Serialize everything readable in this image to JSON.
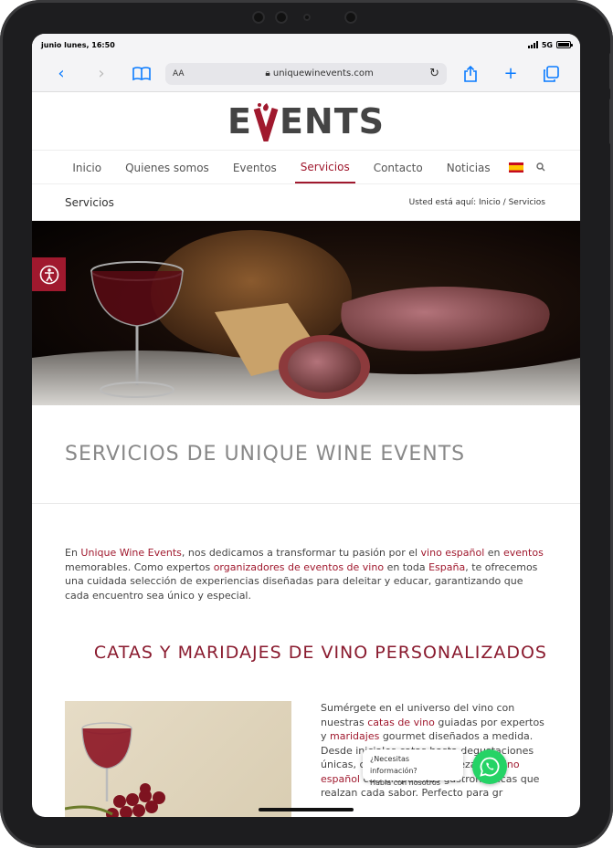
{
  "status": {
    "time": "junio lunes, 16:50",
    "network": "5G"
  },
  "browser": {
    "aa": "AA",
    "url": "uniquewinevents.com"
  },
  "site": {
    "logo": {
      "pre": "E",
      "v": "V",
      "post": "ENTS"
    },
    "nav": [
      "Inicio",
      "Quienes somos",
      "Eventos",
      "Servicios",
      "Contacto",
      "Noticias"
    ],
    "nav_active": "Servicios",
    "page_title": "Servicios",
    "breadcrumb": "Usted está aquí:  Inicio  / Servicios",
    "heading": "SERVICIOS DE UNIQUE WINE EVENTS",
    "intro": {
      "p1": "En ",
      "l1": "Unique Wine Events",
      "p2": ", nos dedicamos a transformar tu pasión por el ",
      "l2": "vino español",
      "p3": " en ",
      "l3": "eventos",
      "p4": " memorables. Como expertos ",
      "l4": "organizadores de eventos de vino",
      "p5": " en toda ",
      "l5": "España",
      "p6": ", te ofrecemos una cuidada selección de experiencias diseñadas para deleitar y educar, garantizando que cada encuentro sea único y especial."
    },
    "section_title": "CATAS Y MARIDAJES DE VINO PERSONALIZADOS",
    "section": {
      "p1": "Sumérgete en el universo del vino con nuestras ",
      "l1": "catas de vino",
      "p2": " guiadas por expertos y ",
      "l2": "maridajes",
      "p3": " gourmet diseñados a medida. Desde ini",
      "p4": "ciales catas hasta degustac",
      "p5": "iones únicas, combinamos la riqueza del ",
      "l3": "vino español",
      "p6": " con propuestas gastronómicas que realzan cada sabor. Perfecto para gr"
    },
    "chat": {
      "line1": "¿Necesitas información?",
      "line2": "Habla con nosotros"
    }
  },
  "colors": {
    "brand": "#a0192e",
    "whatsapp": "#25d366"
  }
}
